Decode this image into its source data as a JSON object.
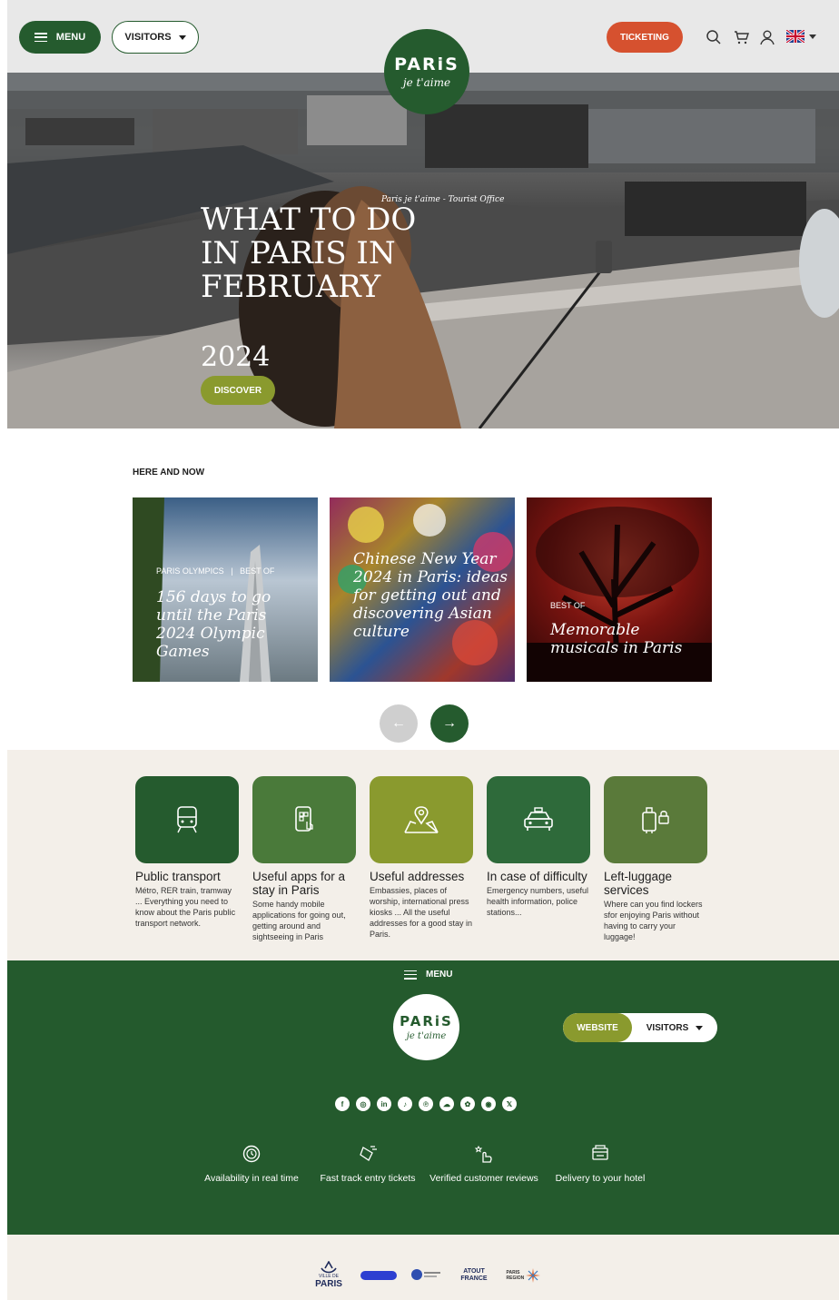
{
  "header": {
    "menu_label": "MENU",
    "visitors_label": "VISITORS",
    "logo_title": "PARiS",
    "logo_tagline": "je t'aime",
    "ticketing_label": "TICKETING",
    "icons": [
      "search-icon",
      "cart-icon",
      "user-icon",
      "uk-flag-icon"
    ]
  },
  "hero": {
    "subtitle": "Paris je t'aime - Tourist Office",
    "title": "WHAT TO DO IN PARIS IN FEBRUARY",
    "year": "2024",
    "cta_label": "DISCOVER"
  },
  "here_and_now": {
    "section_label": "HERE AND NOW",
    "cards": [
      {
        "tags": [
          "PARIS OLYMPICS",
          "BEST OF"
        ],
        "title": "156 days to go until the Paris 2024 Olympic Games"
      },
      {
        "tags": [],
        "title": "Chinese New Year 2024 in Paris: ideas for getting out and discovering Asian culture"
      },
      {
        "tags": [
          "BEST OF"
        ],
        "title": "Memorable musicals in Paris"
      }
    ],
    "prev_label": "←",
    "next_label": "→"
  },
  "services": [
    {
      "icon": "train-icon",
      "title": "Public transport",
      "desc": "Métro, RER train, tramway ... Everything you need to know about the Paris public transport network.",
      "color": "#255b2e"
    },
    {
      "icon": "mobile-app-icon",
      "title": "Useful apps for a stay in Paris",
      "desc": "Some handy mobile applications for going out, getting around and sightseeing in Paris",
      "color": "#4a7a3a"
    },
    {
      "icon": "map-pin-icon",
      "title": "Useful addresses",
      "desc": "Embassies, places of worship, international press kiosks ... All the useful addresses for a good stay in Paris.",
      "color": "#8a9a2e"
    },
    {
      "icon": "emergency-car-icon",
      "title": "In case of difficulty",
      "desc": "Emergency numbers, useful health information, police stations...",
      "color": "#2e6a3a"
    },
    {
      "icon": "luggage-lock-icon",
      "title": "Left-luggage services",
      "desc": "Where can you find lockers sfor enjoying Paris without having to carry your luggage!",
      "color": "#5a7a3a"
    }
  ],
  "footer": {
    "menu_label": "MENU",
    "logo_title": "PARiS",
    "logo_tagline": "je t'aime",
    "website_label": "WEBSITE",
    "visitors_label": "VISITORS",
    "socials": [
      "f",
      "◎",
      "in",
      "♪",
      "℗",
      "☁",
      "✿",
      "◉",
      "𝕏"
    ],
    "social_names": [
      "facebook-icon",
      "instagram-icon",
      "linkedin-icon",
      "tiktok-icon",
      "pinterest-icon",
      "wechat-icon",
      "douyin-icon",
      "weibo-icon",
      "x-icon"
    ],
    "features": [
      {
        "icon": "clock-icon",
        "label": "Availability in real time"
      },
      {
        "icon": "fast-ticket-icon",
        "label": "Fast track entry tickets"
      },
      {
        "icon": "verified-review-icon",
        "label": "Verified customer reviews"
      },
      {
        "icon": "hotel-delivery-icon",
        "label": "Delivery to your hotel"
      }
    ]
  },
  "partners": {
    "ville_de_paris": "PARIS",
    "ville_de_paris_small": "VILLE DE",
    "atout_france": "ATOUT FRANCE",
    "paris_region": "PARIS REGION"
  },
  "colors": {
    "brand_green": "#255b2e",
    "accent_olive": "#8a9a2e",
    "ticket_orange": "#d6512f",
    "beige": "#f3efe9"
  }
}
